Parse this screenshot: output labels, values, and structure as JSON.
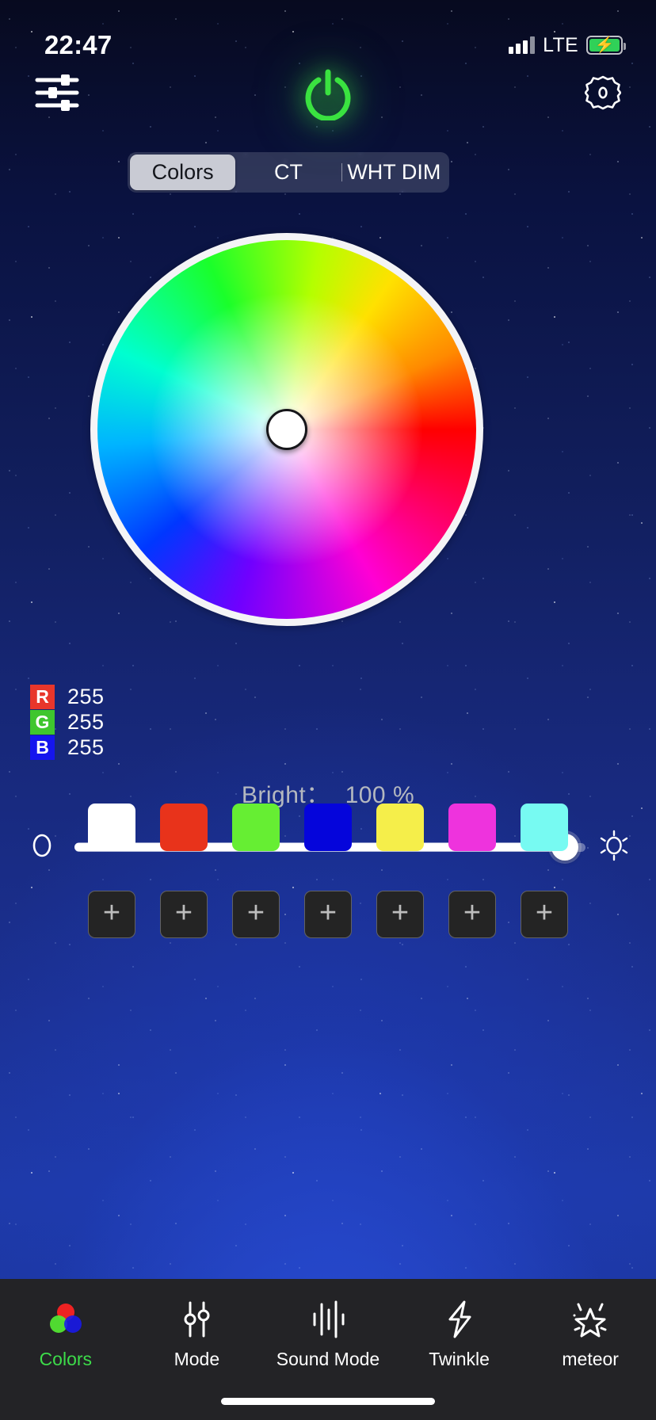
{
  "status_bar": {
    "time": "22:47",
    "network": "LTE",
    "signal_bars": 3,
    "signal_bars_total": 4,
    "battery_charging": true,
    "battery_level_pct": 100,
    "battery_color": "#30d158",
    "bolt_glyph": "⚡"
  },
  "header": {
    "eq_icon": "sliders-icon",
    "power_icon": "power-icon",
    "power_state": "on",
    "power_color": "#3ae240",
    "gear_icon": "gear-icon"
  },
  "segmented_control": {
    "selected": "Colors",
    "tabs": [
      {
        "label": "Colors",
        "selected": true
      },
      {
        "label": "CT",
        "selected": false
      },
      {
        "label": "WHT DIM",
        "selected": false
      }
    ]
  },
  "color_wheel": {
    "name": "hsv-color-wheel",
    "selected_point": "center",
    "selected_hex": "#FFFFFF",
    "thumb_fill": "#FFFFFF",
    "ring_color": "#F4F4F6"
  },
  "rgb_readout": [
    {
      "channel": "R",
      "value": "255",
      "badge_color": "#E8362B"
    },
    {
      "channel": "G",
      "value": "255",
      "badge_color": "#3FC62E"
    },
    {
      "channel": "B",
      "value": "255",
      "badge_color": "#1515EE"
    }
  ],
  "brightness": {
    "label": "Bright：",
    "value_text": "100 %",
    "value": 100,
    "min": 0,
    "max": 100,
    "fill_pct": 96,
    "left_icon": "dim-circle-icon",
    "right_icon": "sun-brightness-icon"
  },
  "presets": [
    {
      "name": "preset-white",
      "color": "#FFFFFF"
    },
    {
      "name": "preset-red",
      "color": "#E8331B"
    },
    {
      "name": "preset-green",
      "color": "#66EE33"
    },
    {
      "name": "preset-blue",
      "color": "#0505DB"
    },
    {
      "name": "preset-yellow",
      "color": "#F5EE4A"
    },
    {
      "name": "preset-magenta",
      "color": "#EE33DD"
    },
    {
      "name": "preset-cyan",
      "color": "#77FAF2"
    }
  ],
  "add_slots": [
    {
      "label": "+"
    },
    {
      "label": "+"
    },
    {
      "label": "+"
    },
    {
      "label": "+"
    },
    {
      "label": "+"
    },
    {
      "label": "+"
    },
    {
      "label": "+"
    }
  ],
  "bottom_nav": {
    "active": "Colors",
    "active_color": "#3DDC4A",
    "items": [
      {
        "label": "Colors",
        "icon": "rgb-circles-icon",
        "active": true
      },
      {
        "label": "Mode",
        "icon": "sliders-vertical-icon",
        "active": false
      },
      {
        "label": "Sound Mode",
        "icon": "audio-bars-icon",
        "active": false
      },
      {
        "label": "Twinkle",
        "icon": "lightning-bolt-icon",
        "active": false
      },
      {
        "label": "meteor",
        "icon": "sparkle-star-icon",
        "active": false
      }
    ]
  }
}
